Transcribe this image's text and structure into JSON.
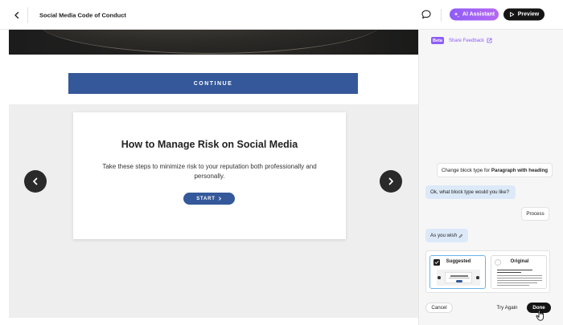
{
  "header": {
    "title": "Social Media Code of Conduct",
    "ai_assistant_label": "AI Assistant",
    "preview_label": "Preview"
  },
  "canvas": {
    "continue_label": "CONTINUE",
    "card": {
      "heading": "How to Manage Risk on Social Media",
      "body": "Take these steps to minimize risk to your reputation both professionally and personally.",
      "start_label": "START"
    }
  },
  "panel": {
    "beta_label": "Beta",
    "share_feedback_label": "Share Feedback",
    "messages": [
      {
        "role": "user",
        "text_prefix": "Change block type for ",
        "text_strong": "Paragraph with heading"
      },
      {
        "role": "assistant",
        "text": "Ok, what block type would you like?"
      },
      {
        "role": "user",
        "text": "Process"
      },
      {
        "role": "assistant",
        "text": "As you wish",
        "suffix_icon": "pencil-icon"
      }
    ],
    "options": [
      {
        "label": "Suggested",
        "selected": true
      },
      {
        "label": "Original",
        "selected": false
      }
    ],
    "cancel_label": "Cancel",
    "try_again_label": "Try Again",
    "done_label": "Done"
  },
  "colors": {
    "accent_purple": "#8f5cf7",
    "brand_blue": "#34589a",
    "ai_bubble": "#dce9f8",
    "selected_border": "#6bb3ea"
  }
}
